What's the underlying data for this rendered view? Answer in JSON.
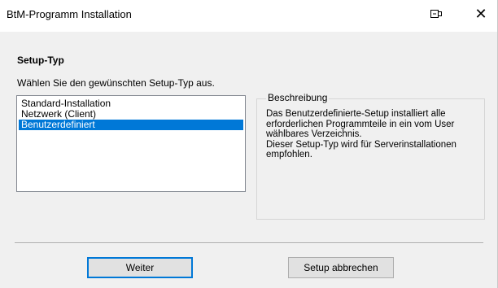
{
  "window": {
    "title": "BtM-Programm Installation",
    "controls": {
      "pin_icon": "pin-icon",
      "close_label": "✕"
    }
  },
  "setup": {
    "section_title": "Setup-Typ",
    "instruction": "Wählen Sie den gewünschten Setup-Typ aus.",
    "options": [
      "Standard-Installation",
      "Netzwerk (Client)",
      "Benutzerdefiniert"
    ],
    "selected_option": "Benutzerdefiniert"
  },
  "description": {
    "legend": "Beschreibung",
    "lines": [
      "Das Benutzerdefinierte-Setup installiert alle",
      "erforderlichen Programmteile in ein vom User",
      "wählbares Verzeichnis.",
      "Dieser Setup-Typ wird für Serverinstallationen",
      "empfohlen."
    ]
  },
  "buttons": {
    "next_label": "Weiter",
    "cancel_label": "Setup abbrechen"
  },
  "colors": {
    "selection": "#0078d7",
    "dialog_bg": "#f0f0f0"
  }
}
